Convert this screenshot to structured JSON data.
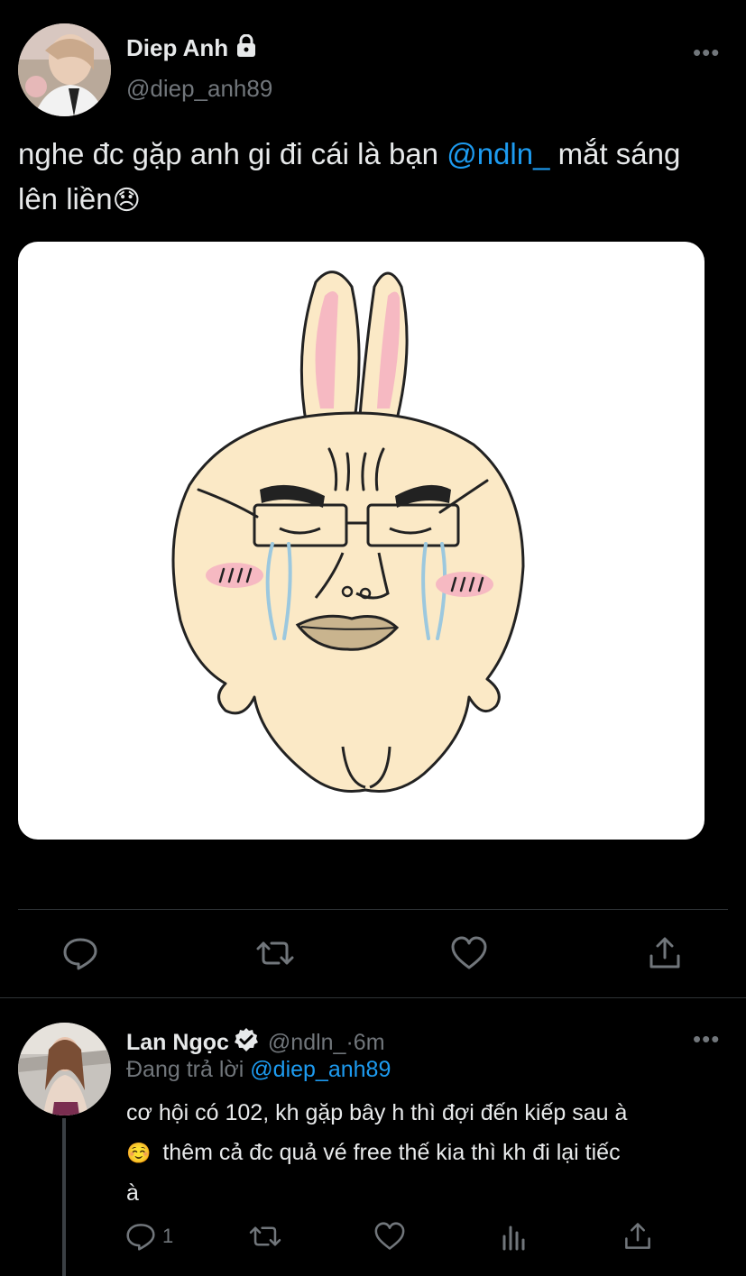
{
  "tweet": {
    "author_name": "Diep Anh",
    "author_handle": "@diep_anh89",
    "text_before": "nghe đc gặp anh gi đi cái là bạn ",
    "mention": "@ndln_",
    "text_after": " mắt sáng lên liền",
    "emoji": "😞",
    "more": "•••",
    "image_subject": "crying-rabbit-sticker"
  },
  "reply": {
    "author_name": "Lan Ngọc",
    "author_handle": "@ndln_",
    "separator": " · ",
    "time": "6m",
    "replying_prefix": "Đang trả lời ",
    "replying_to": "@diep_anh89",
    "line1": "cơ hội có 102, kh gặp bây h thì đợi đến kiếp sau à",
    "emoji": "☺️",
    "line2": " thêm cả đc quả vé free thế kia thì kh đi lại tiếc",
    "line3": "à",
    "reply_count": "1",
    "more": "•••"
  },
  "colors": {
    "background": "#000000",
    "text": "#e7e9ea",
    "muted": "#71767b",
    "link": "#1d9bf0",
    "divider": "#2f3336"
  },
  "icons": [
    "lock-icon",
    "verified-icon",
    "reply-icon",
    "retweet-icon",
    "like-icon",
    "share-icon",
    "analytics-icon",
    "more-icon"
  ]
}
